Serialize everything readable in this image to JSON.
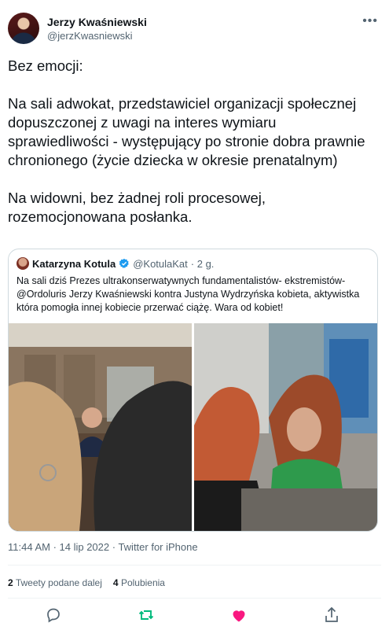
{
  "author": {
    "name": "Jerzy Kwaśniewski",
    "handle": "@jerzKwasniewski"
  },
  "tweet": {
    "text": "Bez emocji:\n\nNa sali adwokat, przedstawiciel organizacji społecznej dopuszczonej z uwagi na interes wymiaru sprawiedliwości - występujący po stronie dobra prawnie chronionego (życie dziecka w okresie prenatalnym)\n\nNa widowni, bez żadnej roli procesowej, rozemocjonowana posłanka."
  },
  "quote": {
    "name": "Katarzyna Kotula",
    "handle": "@KotulaKat",
    "time": "· 2 g.",
    "text": "Na sali dziś Prezes ultrakonserwatywnych fundamentalistów- ekstremistów- @Ordoluris  Jerzy Kwaśniewski kontra Justyna Wydrzyńska kobieta, aktywistka która pomogła innej kobiecie przerwać ciążę. Wara od kobiet!"
  },
  "meta": {
    "timestamp": "11:44 AM · 14 lip 2022 · Twitter for iPhone"
  },
  "stats": {
    "retweets_count": "2",
    "retweets_label": "Tweety podane dalej",
    "likes_count": "4",
    "likes_label": "Polubienia"
  },
  "icons": {
    "more": "more-icon",
    "verified": "verified-badge-icon",
    "reply": "reply-icon",
    "retweet": "retweet-icon",
    "like": "like-icon",
    "share": "share-icon"
  },
  "colors": {
    "retweet_active": "#00ba7c",
    "like_active": "#f91880",
    "verified": "#1d9bf0",
    "secondary_text": "#536471"
  }
}
